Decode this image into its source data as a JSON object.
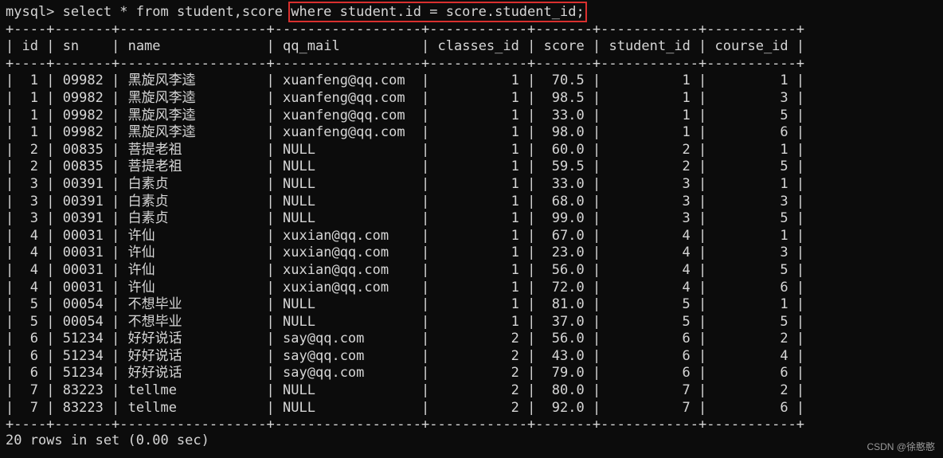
{
  "command": {
    "prompt": "mysql> ",
    "query_start": "select * from student,score ",
    "query_highlighted": "where student.id = score.student_id;"
  },
  "table": {
    "columns": [
      "id",
      "sn",
      "name",
      "qq_mail",
      "classes_id",
      "score",
      "student_id",
      "course_id"
    ],
    "rows": [
      [
        "1",
        "09982",
        "黑旋风李逵",
        "xuanfeng@qq.com",
        "1",
        "70.5",
        "1",
        "1"
      ],
      [
        "1",
        "09982",
        "黑旋风李逵",
        "xuanfeng@qq.com",
        "1",
        "98.5",
        "1",
        "3"
      ],
      [
        "1",
        "09982",
        "黑旋风李逵",
        "xuanfeng@qq.com",
        "1",
        "33.0",
        "1",
        "5"
      ],
      [
        "1",
        "09982",
        "黑旋风李逵",
        "xuanfeng@qq.com",
        "1",
        "98.0",
        "1",
        "6"
      ],
      [
        "2",
        "00835",
        "菩提老祖",
        "NULL",
        "1",
        "60.0",
        "2",
        "1"
      ],
      [
        "2",
        "00835",
        "菩提老祖",
        "NULL",
        "1",
        "59.5",
        "2",
        "5"
      ],
      [
        "3",
        "00391",
        "白素贞",
        "NULL",
        "1",
        "33.0",
        "3",
        "1"
      ],
      [
        "3",
        "00391",
        "白素贞",
        "NULL",
        "1",
        "68.0",
        "3",
        "3"
      ],
      [
        "3",
        "00391",
        "白素贞",
        "NULL",
        "1",
        "99.0",
        "3",
        "5"
      ],
      [
        "4",
        "00031",
        "许仙",
        "xuxian@qq.com",
        "1",
        "67.0",
        "4",
        "1"
      ],
      [
        "4",
        "00031",
        "许仙",
        "xuxian@qq.com",
        "1",
        "23.0",
        "4",
        "3"
      ],
      [
        "4",
        "00031",
        "许仙",
        "xuxian@qq.com",
        "1",
        "56.0",
        "4",
        "5"
      ],
      [
        "4",
        "00031",
        "许仙",
        "xuxian@qq.com",
        "1",
        "72.0",
        "4",
        "6"
      ],
      [
        "5",
        "00054",
        "不想毕业",
        "NULL",
        "1",
        "81.0",
        "5",
        "1"
      ],
      [
        "5",
        "00054",
        "不想毕业",
        "NULL",
        "1",
        "37.0",
        "5",
        "5"
      ],
      [
        "6",
        "51234",
        "好好说话",
        "say@qq.com",
        "2",
        "56.0",
        "6",
        "2"
      ],
      [
        "6",
        "51234",
        "好好说话",
        "say@qq.com",
        "2",
        "43.0",
        "6",
        "4"
      ],
      [
        "6",
        "51234",
        "好好说话",
        "say@qq.com",
        "2",
        "79.0",
        "6",
        "6"
      ],
      [
        "7",
        "83223",
        "tellme",
        "NULL",
        "2",
        "80.0",
        "7",
        "2"
      ],
      [
        "7",
        "83223",
        "tellme",
        "NULL",
        "2",
        "92.0",
        "7",
        "6"
      ]
    ]
  },
  "footer": "20 rows in set (0.00 sec)",
  "watermark": "CSDN @徐憨憨"
}
